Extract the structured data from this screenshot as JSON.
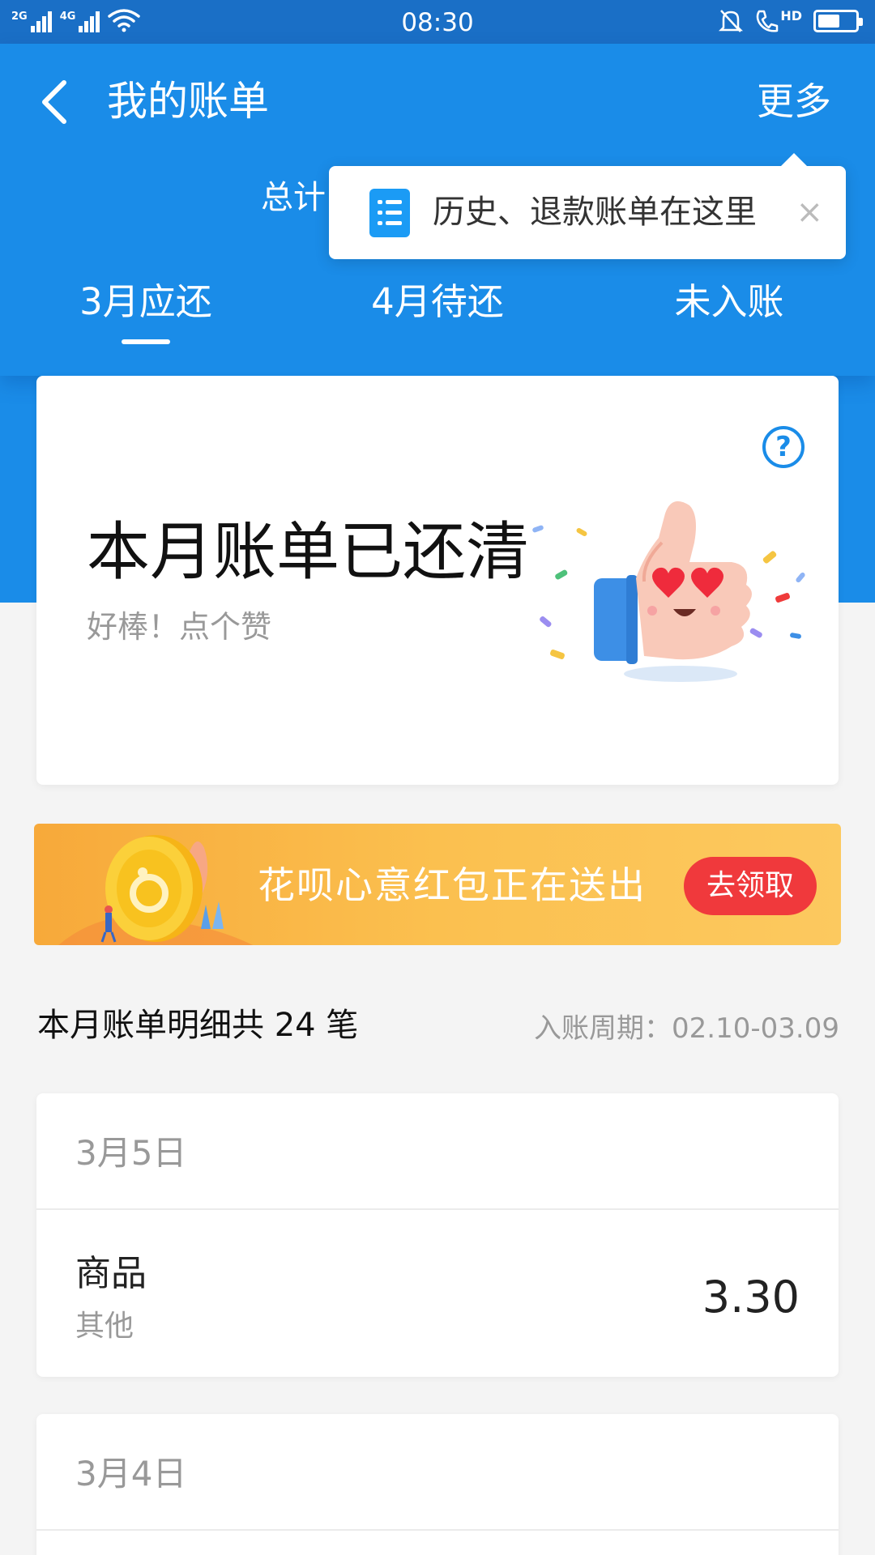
{
  "status_bar": {
    "network_1": "2G",
    "network_2": "4G",
    "time": "08:30",
    "hd": "HD",
    "battery_level": 0.6
  },
  "header": {
    "title": "我的账单",
    "more_label": "更多",
    "total_label": "总计"
  },
  "popup": {
    "text": "历史、退款账单在这里",
    "close_symbol": "×"
  },
  "tabs": [
    {
      "label": "3月应还",
      "active": true
    },
    {
      "label": "4月待还",
      "active": false
    },
    {
      "label": "未入账",
      "active": false
    }
  ],
  "status_card": {
    "help_symbol": "?",
    "title": "本月账单已还清",
    "subtitle": "好棒！点个赞"
  },
  "banner": {
    "text": "花呗心意红包正在送出",
    "button_label": "去领取"
  },
  "bill_summary": {
    "count_text": "本月账单明细共 24 笔",
    "period_text": "入账周期：02.10-03.09"
  },
  "days": [
    {
      "date": "3月5日",
      "items": [
        {
          "name": "商品",
          "category": "其他",
          "amount": "3.30"
        }
      ]
    },
    {
      "date": "3月4日",
      "items": []
    }
  ],
  "colors": {
    "header_blue": "#1a8ce8",
    "status_bar_blue": "#1a6fc6",
    "banner_orange": "#fbc04f",
    "button_red": "#f0393c"
  }
}
